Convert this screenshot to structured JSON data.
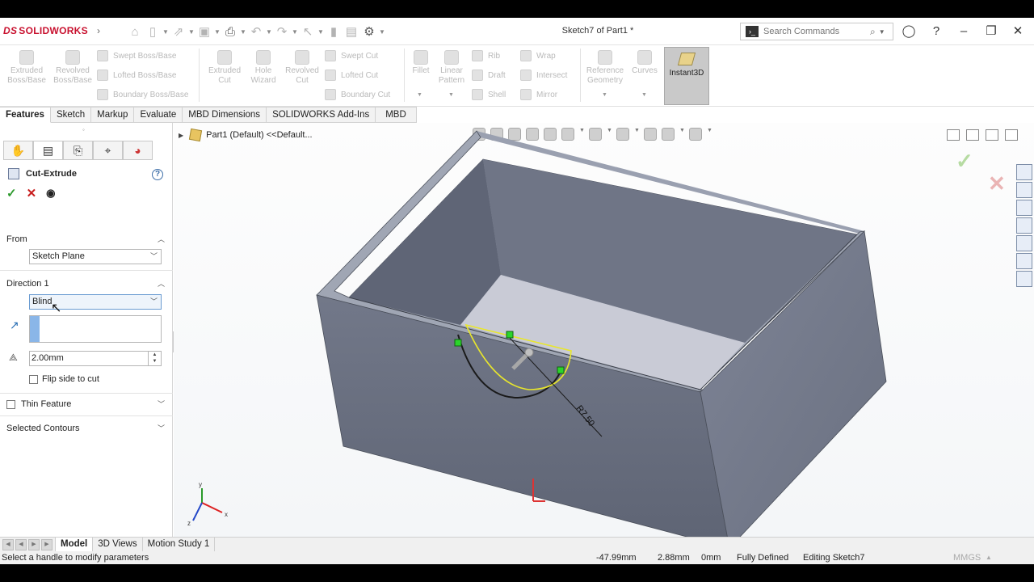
{
  "app": {
    "brand": "SOLIDWORKS",
    "brand_prefix": "DS",
    "document_title": "Sketch7 of Part1 *"
  },
  "search": {
    "placeholder": "Search Commands"
  },
  "commands": {
    "extruded_boss": "Extruded Boss/Base",
    "revolved_boss": "Revolved Boss/Base",
    "swept_boss": "Swept Boss/Base",
    "lofted_boss": "Lofted Boss/Base",
    "boundary_boss": "Boundary Boss/Base",
    "extruded_cut": "Extruded Cut",
    "hole_wizard": "Hole Wizard",
    "revolved_cut": "Revolved Cut",
    "swept_cut": "Swept Cut",
    "lofted_cut": "Lofted Cut",
    "boundary_cut": "Boundary Cut",
    "fillet": "Fillet",
    "linear_pattern": "Linear Pattern",
    "rib": "Rib",
    "draft": "Draft",
    "shell": "Shell",
    "wrap": "Wrap",
    "intersect": "Intersect",
    "mirror": "Mirror",
    "reference_geometry": "Reference Geometry",
    "curves": "Curves",
    "instant3d": "Instant3D"
  },
  "tabs": [
    "Features",
    "Sketch",
    "Markup",
    "Evaluate",
    "MBD Dimensions",
    "SOLIDWORKS Add-Ins",
    "MBD"
  ],
  "property_manager": {
    "title": "Cut-Extrude",
    "from_label": "From",
    "from_value": "Sketch Plane",
    "direction1_label": "Direction 1",
    "end_condition": "Blind",
    "depth": "2.00mm",
    "flip_side": "Flip side to cut",
    "thin_feature": "Thin Feature",
    "selected_contours": "Selected Contours"
  },
  "tree": {
    "root": "Part1 (Default) <<Default..."
  },
  "viewport": {
    "dimension_label": "R7.50",
    "triad": {
      "x": "x",
      "y": "y",
      "z": "z"
    }
  },
  "bottom_tabs": [
    "Model",
    "3D Views",
    "Motion Study 1"
  ],
  "status": {
    "message": "Select a handle to modify parameters",
    "x": "-47.99mm",
    "y": "2.88mm",
    "z": "0mm",
    "state": "Fully Defined",
    "editing": "Editing Sketch7",
    "units": "MMGS"
  }
}
